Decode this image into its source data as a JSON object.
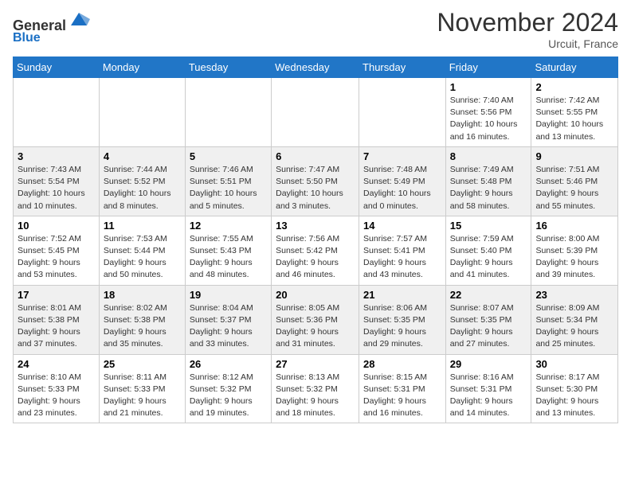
{
  "header": {
    "logo_line1": "General",
    "logo_line2": "Blue",
    "month_title": "November 2024",
    "location": "Urcuit, France"
  },
  "days_of_week": [
    "Sunday",
    "Monday",
    "Tuesday",
    "Wednesday",
    "Thursday",
    "Friday",
    "Saturday"
  ],
  "weeks": [
    [
      {
        "day": "",
        "info": ""
      },
      {
        "day": "",
        "info": ""
      },
      {
        "day": "",
        "info": ""
      },
      {
        "day": "",
        "info": ""
      },
      {
        "day": "",
        "info": ""
      },
      {
        "day": "1",
        "info": "Sunrise: 7:40 AM\nSunset: 5:56 PM\nDaylight: 10 hours\nand 16 minutes."
      },
      {
        "day": "2",
        "info": "Sunrise: 7:42 AM\nSunset: 5:55 PM\nDaylight: 10 hours\nand 13 minutes."
      }
    ],
    [
      {
        "day": "3",
        "info": "Sunrise: 7:43 AM\nSunset: 5:54 PM\nDaylight: 10 hours\nand 10 minutes."
      },
      {
        "day": "4",
        "info": "Sunrise: 7:44 AM\nSunset: 5:52 PM\nDaylight: 10 hours\nand 8 minutes."
      },
      {
        "day": "5",
        "info": "Sunrise: 7:46 AM\nSunset: 5:51 PM\nDaylight: 10 hours\nand 5 minutes."
      },
      {
        "day": "6",
        "info": "Sunrise: 7:47 AM\nSunset: 5:50 PM\nDaylight: 10 hours\nand 3 minutes."
      },
      {
        "day": "7",
        "info": "Sunrise: 7:48 AM\nSunset: 5:49 PM\nDaylight: 10 hours\nand 0 minutes."
      },
      {
        "day": "8",
        "info": "Sunrise: 7:49 AM\nSunset: 5:48 PM\nDaylight: 9 hours\nand 58 minutes."
      },
      {
        "day": "9",
        "info": "Sunrise: 7:51 AM\nSunset: 5:46 PM\nDaylight: 9 hours\nand 55 minutes."
      }
    ],
    [
      {
        "day": "10",
        "info": "Sunrise: 7:52 AM\nSunset: 5:45 PM\nDaylight: 9 hours\nand 53 minutes."
      },
      {
        "day": "11",
        "info": "Sunrise: 7:53 AM\nSunset: 5:44 PM\nDaylight: 9 hours\nand 50 minutes."
      },
      {
        "day": "12",
        "info": "Sunrise: 7:55 AM\nSunset: 5:43 PM\nDaylight: 9 hours\nand 48 minutes."
      },
      {
        "day": "13",
        "info": "Sunrise: 7:56 AM\nSunset: 5:42 PM\nDaylight: 9 hours\nand 46 minutes."
      },
      {
        "day": "14",
        "info": "Sunrise: 7:57 AM\nSunset: 5:41 PM\nDaylight: 9 hours\nand 43 minutes."
      },
      {
        "day": "15",
        "info": "Sunrise: 7:59 AM\nSunset: 5:40 PM\nDaylight: 9 hours\nand 41 minutes."
      },
      {
        "day": "16",
        "info": "Sunrise: 8:00 AM\nSunset: 5:39 PM\nDaylight: 9 hours\nand 39 minutes."
      }
    ],
    [
      {
        "day": "17",
        "info": "Sunrise: 8:01 AM\nSunset: 5:38 PM\nDaylight: 9 hours\nand 37 minutes."
      },
      {
        "day": "18",
        "info": "Sunrise: 8:02 AM\nSunset: 5:38 PM\nDaylight: 9 hours\nand 35 minutes."
      },
      {
        "day": "19",
        "info": "Sunrise: 8:04 AM\nSunset: 5:37 PM\nDaylight: 9 hours\nand 33 minutes."
      },
      {
        "day": "20",
        "info": "Sunrise: 8:05 AM\nSunset: 5:36 PM\nDaylight: 9 hours\nand 31 minutes."
      },
      {
        "day": "21",
        "info": "Sunrise: 8:06 AM\nSunset: 5:35 PM\nDaylight: 9 hours\nand 29 minutes."
      },
      {
        "day": "22",
        "info": "Sunrise: 8:07 AM\nSunset: 5:35 PM\nDaylight: 9 hours\nand 27 minutes."
      },
      {
        "day": "23",
        "info": "Sunrise: 8:09 AM\nSunset: 5:34 PM\nDaylight: 9 hours\nand 25 minutes."
      }
    ],
    [
      {
        "day": "24",
        "info": "Sunrise: 8:10 AM\nSunset: 5:33 PM\nDaylight: 9 hours\nand 23 minutes."
      },
      {
        "day": "25",
        "info": "Sunrise: 8:11 AM\nSunset: 5:33 PM\nDaylight: 9 hours\nand 21 minutes."
      },
      {
        "day": "26",
        "info": "Sunrise: 8:12 AM\nSunset: 5:32 PM\nDaylight: 9 hours\nand 19 minutes."
      },
      {
        "day": "27",
        "info": "Sunrise: 8:13 AM\nSunset: 5:32 PM\nDaylight: 9 hours\nand 18 minutes."
      },
      {
        "day": "28",
        "info": "Sunrise: 8:15 AM\nSunset: 5:31 PM\nDaylight: 9 hours\nand 16 minutes."
      },
      {
        "day": "29",
        "info": "Sunrise: 8:16 AM\nSunset: 5:31 PM\nDaylight: 9 hours\nand 14 minutes."
      },
      {
        "day": "30",
        "info": "Sunrise: 8:17 AM\nSunset: 5:30 PM\nDaylight: 9 hours\nand 13 minutes."
      }
    ]
  ]
}
